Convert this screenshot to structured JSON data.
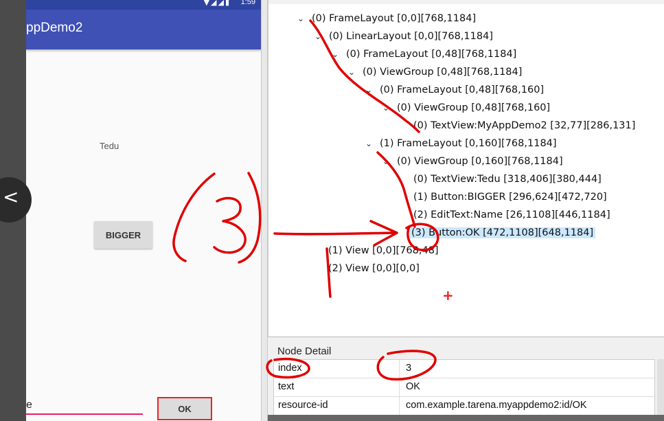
{
  "phone": {
    "time": "1:59",
    "status_icons": "▼◢◢▮",
    "app_title": "ppDemo2",
    "tedu_text": "Tedu",
    "bigger_label": "BIGGER",
    "name_value": "e",
    "ok_label": "OK"
  },
  "back_chevron": "<",
  "tree": {
    "nodes": [
      {
        "label": "(0) FrameLayout [0,0][768,1184]"
      },
      {
        "label": "(0) LinearLayout [0,0][768,1184]"
      },
      {
        "label": "(0) FrameLayout [0,48][768,1184]"
      },
      {
        "label": "(0) ViewGroup [0,48][768,1184]"
      },
      {
        "label": "(0) FrameLayout [0,48][768,160]"
      },
      {
        "label": "(0) ViewGroup [0,48][768,160]"
      },
      {
        "label": "(0) TextView:MyAppDemo2 [32,77][286,131]"
      },
      {
        "label": "(1) FrameLayout [0,160][768,1184]"
      },
      {
        "label": "(0) ViewGroup [0,160][768,1184]"
      },
      {
        "label": "(0) TextView:Tedu [318,406][380,444]"
      },
      {
        "label": "(1) Button:BIGGER [296,624][472,720]"
      },
      {
        "label": "(2) EditText:Name [26,1108][446,1184]"
      },
      {
        "label": "(3) Button:OK [472,1108][648,1184]"
      },
      {
        "label": "(1) View [0,0][768,48]"
      },
      {
        "label": "(2) View [0,0][0,0]"
      }
    ],
    "chevron": "⌄"
  },
  "detail": {
    "title": "Node Detail",
    "rows": [
      {
        "key": "index",
        "value": "3"
      },
      {
        "key": "text",
        "value": "OK"
      },
      {
        "key": "resource-id",
        "value": "com.example.tarena.myappdemo2:id/OK"
      }
    ]
  },
  "colors": {
    "app_bar": "#3f51b5",
    "annotation_red": "#e00000",
    "selection": "#cce8ff"
  }
}
